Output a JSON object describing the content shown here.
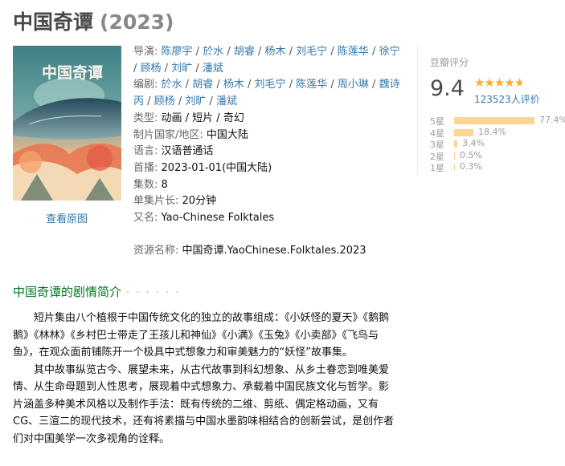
{
  "title": {
    "name": "中国奇谭",
    "year": "(2023)"
  },
  "poster": {
    "caption": "中国奇谭",
    "view_original": "查看原图"
  },
  "info": {
    "director_label": "导演:",
    "directors": [
      "陈廖宇",
      "於水",
      "胡睿",
      "杨木",
      "刘毛宁",
      "陈莲华",
      "徐宁",
      "顾杨",
      "刘旷",
      "潘斌"
    ],
    "writer_label": "编剧:",
    "writers": [
      "於水",
      "胡睿",
      "杨木",
      "刘毛宁",
      "陈莲华",
      "周小琳",
      "魏诗丙",
      "顾杨",
      "刘旷",
      "潘斌"
    ],
    "genre_label": "类型:",
    "genre": "动画 / 短片 / 奇幻",
    "country_label": "制片国家/地区:",
    "country": "中国大陆",
    "language_label": "语言:",
    "language": "汉语普通话",
    "premiere_label": "首播:",
    "premiere": "2023-01-01(中国大陆)",
    "episodes_label": "集数:",
    "episodes": "8",
    "runtime_label": "单集片长:",
    "runtime": "20分钟",
    "aka_label": "又名:",
    "aka": "Yao-Chinese Folktales",
    "resource_label": "资源名称:",
    "resource": "中国奇谭.YaoChinese.Folktales.2023"
  },
  "rating": {
    "label": "豆瓣评分",
    "score": "9.4",
    "stars_value": 4.7,
    "count": "123523人评价",
    "bars": [
      {
        "label": "5星",
        "pct": "77.4%",
        "value": 77.4
      },
      {
        "label": "4星",
        "pct": "18.4%",
        "value": 18.4
      },
      {
        "label": "3星",
        "pct": "3.4%",
        "value": 3.4
      },
      {
        "label": "2星",
        "pct": "0.5%",
        "value": 0.5
      },
      {
        "label": "1星",
        "pct": "0.3%",
        "value": 0.3
      }
    ],
    "bar_color": "#ffd596",
    "star_color": "#ffac2d"
  },
  "synopsis": {
    "title": "中国奇谭的剧情简介",
    "dots": "· · · · · ·",
    "para1": "短片集由八个植根于中国传统文化的独立的故事组成：《小妖怪的夏天》《鹅鹅鹅》《林林》《乡村巴士带走了王孩儿和神仙》《小满》《玉兔》《小卖部》《飞鸟与鱼》，在观众面前铺陈开一个极具中式想象力和审美魅力的“妖怪”故事集。",
    "para2": "其中故事纵览古今、展望未来，从古代故事到科幻想象、从乡土眷恋到唯美爱情、从生命母题到人性思考，展现着中式想象力、承载着中国民族文化与哲学。影片涵盖多种美术风格以及制作手法：既有传统的二维、剪纸、偶定格动画，又有CG、三渲二的现代技术，还有将素描与中国水墨韵味相结合的创新尝试，是创作者们对中国美学一次多视角的诠释。"
  },
  "colors": {
    "link": "#3377aa",
    "section_green": "#007722"
  }
}
